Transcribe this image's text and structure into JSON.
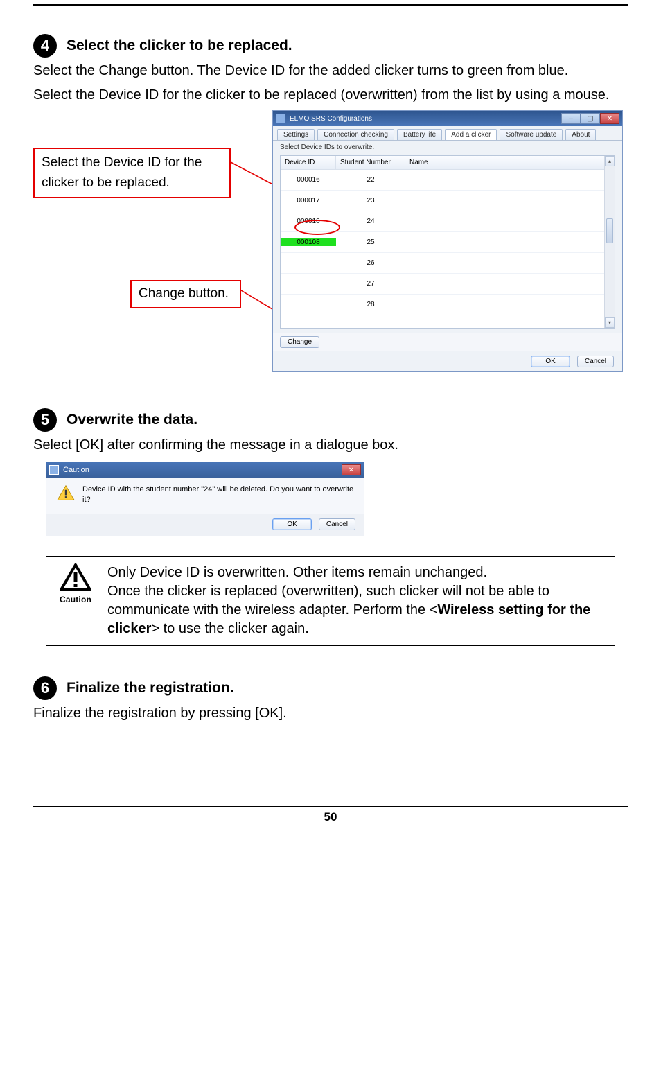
{
  "page_number": "50",
  "steps": {
    "s4": {
      "num": "4",
      "title": "Select the clicker to be replaced.",
      "body_l1": "Select the Change button. The Device ID for the added clicker turns to green from blue.",
      "body_l2": "Select the Device ID for the clicker to be replaced (overwritten) from the list by using a mouse."
    },
    "s5": {
      "num": "5",
      "title": "Overwrite the data.",
      "body": "Select [OK] after confirming the message in a dialogue box."
    },
    "s6": {
      "num": "6",
      "title": "Finalize the registration.",
      "body": "Finalize the registration by pressing [OK]."
    }
  },
  "callouts": {
    "select_device": "Select the Device ID for the clicker to be replaced.",
    "change_button": "Change button."
  },
  "app_window": {
    "title": "ELMO SRS Configurations",
    "tabs": [
      "Settings",
      "Connection checking",
      "Battery life",
      "Add a clicker",
      "Software update",
      "About"
    ],
    "subtext": "Select Device IDs to overwrite.",
    "headers": {
      "id": "Device ID",
      "num": "Student Number",
      "name": "Name"
    },
    "rows": [
      {
        "id": "000016",
        "num": "22",
        "name": ""
      },
      {
        "id": "000017",
        "num": "23",
        "name": ""
      },
      {
        "id": "000018",
        "num": "24",
        "name": ""
      },
      {
        "id": "000108",
        "num": "25",
        "name": "",
        "highlight": true
      },
      {
        "id": "",
        "num": "26",
        "name": ""
      },
      {
        "id": "",
        "num": "27",
        "name": ""
      },
      {
        "id": "",
        "num": "28",
        "name": ""
      }
    ],
    "change_btn": "Change",
    "ok_btn": "OK",
    "cancel_btn": "Cancel"
  },
  "caution_dialog": {
    "title": "Caution",
    "message": "Device ID with the student number \"24\" will be deleted. Do you want to overwrite it?",
    "ok": "OK",
    "cancel": "Cancel"
  },
  "note": {
    "icon_label": "Caution",
    "line1": "Only Device ID is overwritten. Other items remain unchanged.",
    "line2a": "Once the clicker is replaced (overwritten), such clicker will not be able to communicate with the wireless adapter. Perform the <",
    "line2b": "Wireless setting for the clicker",
    "line2c": "> to use the clicker again."
  }
}
